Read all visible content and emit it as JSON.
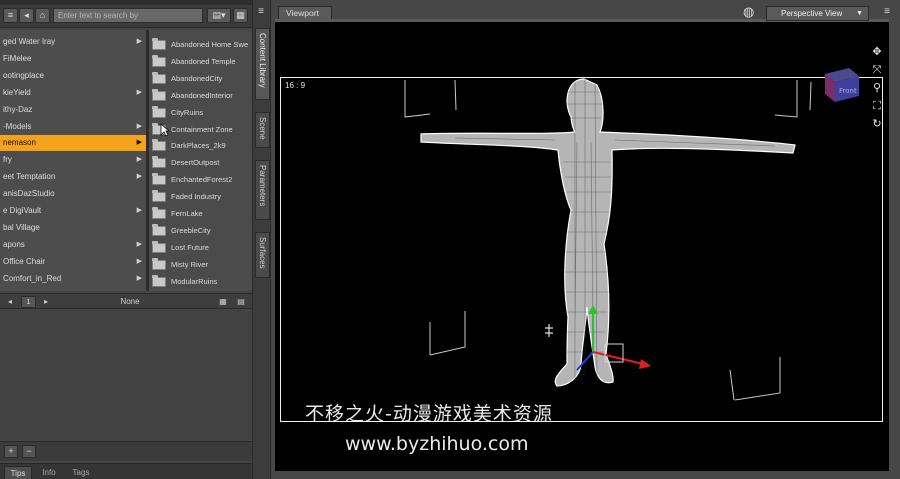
{
  "search": {
    "placeholder": "Enter text to search by"
  },
  "folders": [
    {
      "label": "ged Water Iray",
      "has_children": true
    },
    {
      "label": "FiMelee",
      "has_children": false
    },
    {
      "label": "ootingplace",
      "has_children": false
    },
    {
      "label": "kieYield",
      "has_children": true
    },
    {
      "label": "ithy-Daz",
      "has_children": false
    },
    {
      "label": "-Models",
      "has_children": true
    },
    {
      "label": "nemason",
      "has_children": true,
      "selected": true
    },
    {
      "label": "fry",
      "has_children": true
    },
    {
      "label": "eet Temptation",
      "has_children": true
    },
    {
      "label": "anisDazStudio",
      "has_children": false
    },
    {
      "label": "e DigiVault",
      "has_children": true
    },
    {
      "label": "bal Village",
      "has_children": false
    },
    {
      "label": "apons",
      "has_children": true
    },
    {
      "label": "Office Chair",
      "has_children": true
    },
    {
      "label": "Comfort_in_Red",
      "has_children": true
    }
  ],
  "content_items": [
    "Abandoned Home Swe",
    "Abandoned Temple",
    "AbandonedCity",
    "AbandonedInterior",
    "CityRuins",
    "Containment Zone",
    "DarkPlaces_2k9",
    "DesertOutpost",
    "EnchantedForest2",
    "Faded Industry",
    "FernLake",
    "GreebleCity",
    "Lost Future",
    "Misty River",
    "ModularRuins"
  ],
  "pager": {
    "page": "1",
    "preset": "None"
  },
  "bottom_tabs": [
    "Tips",
    "Info",
    "Tags"
  ],
  "side_tabs": [
    "Content Library",
    "Scene",
    "Parameters",
    "Surfaces"
  ],
  "viewport": {
    "tab_label": "Viewport",
    "camera": "Perspective View",
    "aspect": "16 : 9",
    "cube_face": "Front"
  },
  "watermark": {
    "text_cn": "不移之火-动漫游戏美术资源",
    "url": "www.byzhihuo.com"
  },
  "colors": {
    "selection": "#f4a21b",
    "canvas": "#000000",
    "panel": "#454545"
  },
  "icons": {
    "toolbar": [
      "add-icon",
      "back-icon",
      "home-icon",
      "view-mode-icon"
    ],
    "right_tools": [
      "pan-icon",
      "move-icon",
      "zoom-icon",
      "frame-icon",
      "reset-icon"
    ]
  }
}
